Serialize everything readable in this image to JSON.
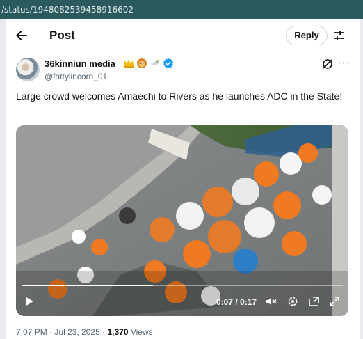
{
  "browser": {
    "url_fragment": "/status/1948082539458916602"
  },
  "header": {
    "title": "Post",
    "reply_button": "Reply"
  },
  "author": {
    "display_name": "36kinniun media",
    "handle": "@fattylincorn_01",
    "verified_color": "#1d9bf0"
  },
  "tweet": {
    "text": "Large crowd welcomes Amaechi to Rivers as he launches ADC in the State!"
  },
  "video": {
    "time_display": "0:07 / 0:17",
    "progress": 0.41
  },
  "meta": {
    "time": "7:07 PM",
    "date": "Jul 23, 2025",
    "separator": "·",
    "views_count": "1,370",
    "views_label": "Views"
  },
  "colors": {
    "url_bar": "#2b5a5e",
    "accent": "#1d9bf0",
    "crowd_orange": "#f07a22"
  }
}
